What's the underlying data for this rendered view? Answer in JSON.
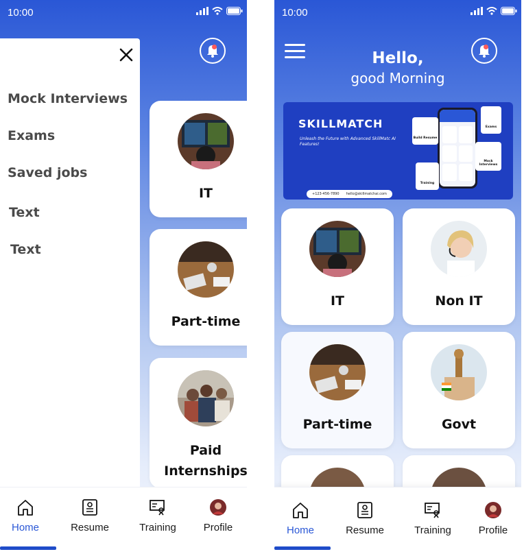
{
  "status": {
    "time": "10:00"
  },
  "colors": {
    "primary": "#2a57d6",
    "notif_dot": "#ff5a5a",
    "text_dark": "#111111",
    "menu_text": "#4a4a4a"
  },
  "left_screen": {
    "drawer": {
      "close_icon": "close-icon",
      "items": [
        {
          "label": "Mock Interviews"
        },
        {
          "label": "Exams"
        },
        {
          "label": "Saved jobs"
        },
        {
          "label": "Text"
        },
        {
          "label": "Text"
        }
      ]
    },
    "cards": [
      {
        "label": "IT",
        "image": "it-photo"
      },
      {
        "label": "Part-time",
        "image": "part-time-photo"
      },
      {
        "label": "Paid Internships",
        "image": "internships-photo"
      }
    ]
  },
  "right_screen": {
    "greeting": {
      "title": "Hello,",
      "subtitle": "good Morning"
    },
    "banner": {
      "brand": "SKILLMATCH",
      "tagline": "Unleash the Future with Advanced SkillMatc AI Features!",
      "phone": "+123-456-7890",
      "email": "hello@skillmatchai.com",
      "chips": [
        "Build Resume",
        "Exams",
        "Mock Interviews",
        "Training"
      ]
    },
    "cards": [
      {
        "label": "IT",
        "image": "it-photo"
      },
      {
        "label": "Non IT",
        "image": "support-agent-photo"
      },
      {
        "label": "Part-time",
        "image": "part-time-photo"
      },
      {
        "label": "Govt",
        "image": "govt-emblem-photo"
      }
    ]
  },
  "nav": {
    "items": [
      {
        "label": "Home",
        "icon": "home-icon",
        "active": true
      },
      {
        "label": "Resume",
        "icon": "resume-icon"
      },
      {
        "label": "Training",
        "icon": "training-icon"
      },
      {
        "label": "Profile",
        "icon": "avatar"
      }
    ]
  }
}
